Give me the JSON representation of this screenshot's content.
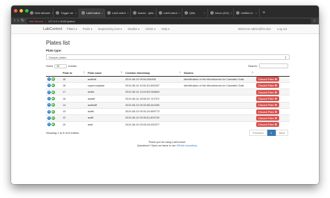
{
  "browser": {
    "tabs": [
      {
        "label": "New labuser",
        "active": false
      },
      {
        "label": "Trigger an",
        "active": false
      },
      {
        "label": "LabControl",
        "active": true
      },
      {
        "label": "LabControl",
        "active": false
      },
      {
        "label": "Issues · qiita",
        "active": false
      },
      {
        "label": "LabControl",
        "active": false
      },
      {
        "label": "Qiita",
        "active": false
      },
      {
        "label": "Inbox (321)",
        "active": false
      },
      {
        "label": "Untitled d",
        "active": false
      }
    ],
    "new_tab": "+",
    "security": "Not Secure",
    "url": "127.0.0.1:8181/plates"
  },
  "appnav": {
    "brand": "LabControl",
    "items": [
      "Plates ▾",
      "Pools ▾",
      "Sequencing runs ▾",
      "Studies ▾",
      "Admin ▾",
      "Help ▾"
    ],
    "welcome": "Welcome admin@foo.bar",
    "logout": "Log out"
  },
  "page": {
    "title": "Plates list",
    "plate_type_label": "Plate type:",
    "plate_type_value": "Sample plates",
    "show_label": "Show",
    "length_value": "10",
    "entries_label": "entries",
    "search_label": "Search:",
    "columns": [
      "",
      "Plate id",
      "Plate name",
      "Creation timestamp",
      "Studies",
      ""
    ],
    "discard_label": "Discard Plate",
    "rows": [
      {
        "id": "18",
        "name": "asdfsdf",
        "ts": "2019-08-13 09:54:264906",
        "studies": "Identification of the Microbiomes for Cannabis Soils"
      },
      {
        "id": "18",
        "name": "superoodplate",
        "ts": "2019-08-14 19:51:51.890337",
        "studies": "Identification of the Microbiomes for Cannabis Soils"
      },
      {
        "id": "17",
        "name": "asdfa",
        "ts": "2019-08-14 19:24:53.048664",
        "studies": ""
      },
      {
        "id": "16",
        "name": "asdfdf",
        "ts": "2019-08-14 18:50:22.747072",
        "studies": ""
      },
      {
        "id": "14",
        "name": "asdfsdff",
        "ts": "2019-08-13 09:32:58.642450",
        "studies": ""
      },
      {
        "id": "13",
        "name": "asdfs",
        "ts": "2019-08-13 09:31:24.669773",
        "studies": ""
      },
      {
        "id": "12",
        "name": "asdff",
        "ts": "2019-08-13 09:30:51.800752",
        "studies": ""
      },
      {
        "id": "10",
        "name": "asdf",
        "ts": "2019-08-13 09:00:43.000377",
        "studies": ""
      }
    ],
    "info": "Showing 1 to 8 of 8 entries",
    "pager": {
      "prev": "Previous",
      "current": "1",
      "next": "Next"
    },
    "thanks_line1": "Thank you for using LabControl.",
    "thanks_line2": "Questions? Open an issue in our",
    "thanks_link": "GitHub repository"
  },
  "colors": {
    "accent": "#337ab7",
    "danger": "#d9534f",
    "chrome": "#2b2b2b"
  }
}
